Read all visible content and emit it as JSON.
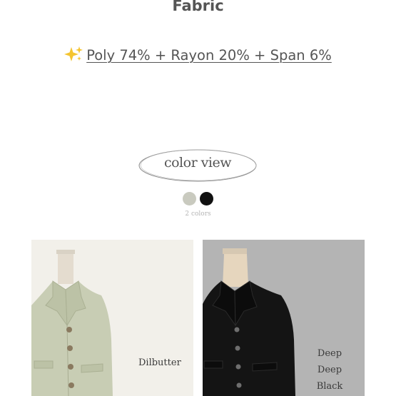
{
  "section": {
    "title": "Fabric",
    "fabric_composition": "Poly 74% + Rayon 20% + Span 6%",
    "sparkle_icon": "sparkles-icon"
  },
  "color_view": {
    "label": "color view",
    "swatches": [
      "#c9cabf",
      "#111111"
    ],
    "count_label": "2 colors"
  },
  "products": [
    {
      "color_name": "Dilbutter",
      "background": "#f2f0ea",
      "garment_color": "#c8cdb4"
    },
    {
      "color_name_lines": [
        "Deep",
        "Deep",
        "Black"
      ],
      "background": "#b4b4b4",
      "garment_color": "#141414"
    }
  ]
}
